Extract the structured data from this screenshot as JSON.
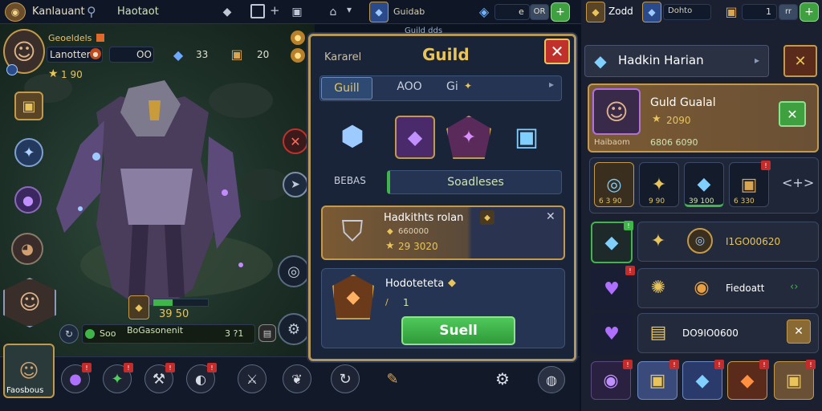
{
  "top": {
    "player_name": "Kanlauant",
    "zone_label": "Haotaot",
    "guild_label": "Guidab",
    "res1_value": "e",
    "res1_badge": "OR",
    "res2_label": "Zodd",
    "res3_label": "Dohto",
    "res4_value": "1",
    "res4_badge": "rr"
  },
  "hero": {
    "title": "Geoeldels",
    "name": "Lanotter",
    "level": "OO",
    "gem_count": "33",
    "chest_count": "20",
    "stars": "1 90",
    "power": "39 50",
    "power_label": "Soo",
    "power_detail": "BoGasonenit",
    "power_detail_value": "3 ?1",
    "portrait_label": "Faosbous"
  },
  "guild_panel": {
    "header_small": "Guild dds",
    "left_label": "Kararel",
    "title": "Guild",
    "tab1": "Guill",
    "tab2": "AOO",
    "tab3": "Gi",
    "row_label": "BEBAS",
    "search_label": "Soadleses",
    "card1_name": "Hadkithts rolan",
    "card1_sub": "660000",
    "card1_value": "29 3020",
    "card2_name": "Hodoteteta",
    "card2_value": "1",
    "action_button": "Suell"
  },
  "right_panel": {
    "title": "Hadkin Harian",
    "guild_name": "Guld Gualal",
    "guild_value": "2090",
    "guild_sub": "Haibaom",
    "guild_sub2": "6806 6090",
    "slot1": "6 3 90",
    "slot2": "9 90",
    "slot3": "39 100",
    "slot4": "6 330",
    "row1_text": "I1GO00620",
    "row2_text": "Fiedoatt",
    "row3_text": "DO9IO0600"
  },
  "colors": {
    "accent_gold": "#e8c45a",
    "panel_bg": "#1a2438",
    "green_button": "#3fb54a",
    "red_close": "#c0312b"
  }
}
